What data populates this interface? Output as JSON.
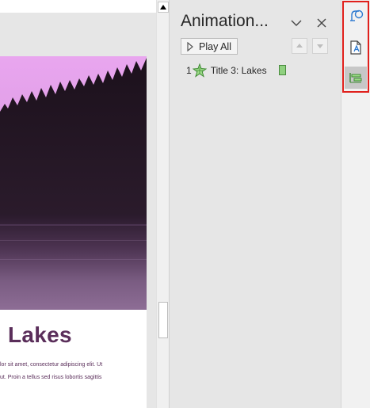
{
  "slide": {
    "title": "Lakes",
    "body_lines": [
      "lor sit amet, consectetur adipiscing elit. Ut",
      "ut. Proin a tellus sed risus lobortis sagittis"
    ]
  },
  "animation_pane": {
    "title": "Animation...",
    "play_all_label": "Play All",
    "items": [
      {
        "number": "1",
        "label": "Title 3: Lakes",
        "effect_icon": "emphasis-star-icon"
      }
    ]
  },
  "rail": {
    "buttons": [
      {
        "icon": "shapes-icon"
      },
      {
        "icon": "alt-text-icon"
      },
      {
        "icon": "animation-pane-icon",
        "active": true
      }
    ]
  },
  "colors": {
    "slide_title": "#5a2e5a",
    "timing_bar": "#8fd07f",
    "highlight_border": "#e0201c",
    "accent_blue": "#2b79d0"
  }
}
